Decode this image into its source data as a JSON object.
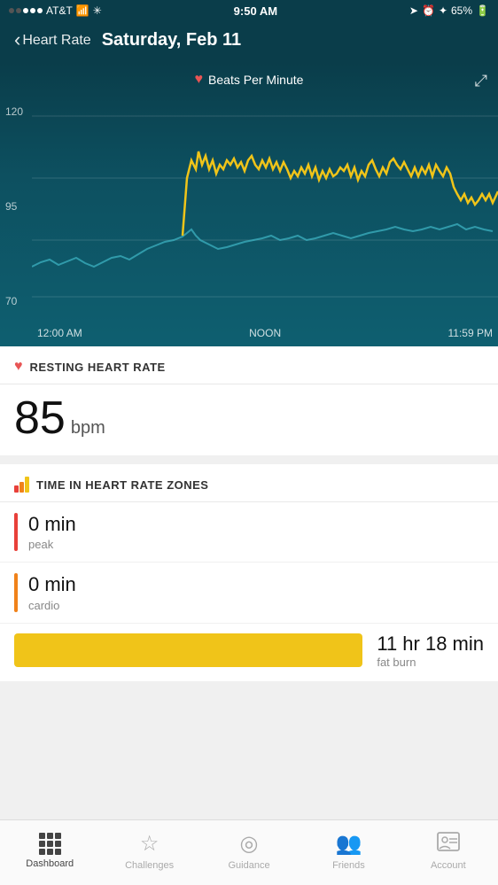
{
  "statusBar": {
    "carrier": "AT&T",
    "time": "9:50 AM",
    "battery": "65%"
  },
  "header": {
    "backLabel": "Heart Rate",
    "title": "Saturday, Feb 11"
  },
  "chart": {
    "legend": "Beats Per Minute",
    "yLabels": [
      "120",
      "95",
      "70"
    ],
    "xLabels": [
      "12:00 AM",
      "NOON",
      "11:59 PM"
    ],
    "expandLabel": "⤢"
  },
  "restingHR": {
    "sectionTitle": "RESTING HEART RATE",
    "value": "85",
    "unit": "bpm"
  },
  "zones": {
    "sectionTitle": "TIME IN HEART RATE ZONES",
    "items": [
      {
        "time": "0 min",
        "label": "peak",
        "color": "peak"
      },
      {
        "time": "0 min",
        "label": "cardio",
        "color": "cardio"
      }
    ],
    "fatburn": {
      "time": "11 hr 18 min",
      "label": "fat burn"
    }
  },
  "nav": {
    "items": [
      {
        "label": "Dashboard",
        "active": true
      },
      {
        "label": "Challenges",
        "active": false
      },
      {
        "label": "Guidance",
        "active": false
      },
      {
        "label": "Friends",
        "active": false
      },
      {
        "label": "Account",
        "active": false
      }
    ]
  }
}
